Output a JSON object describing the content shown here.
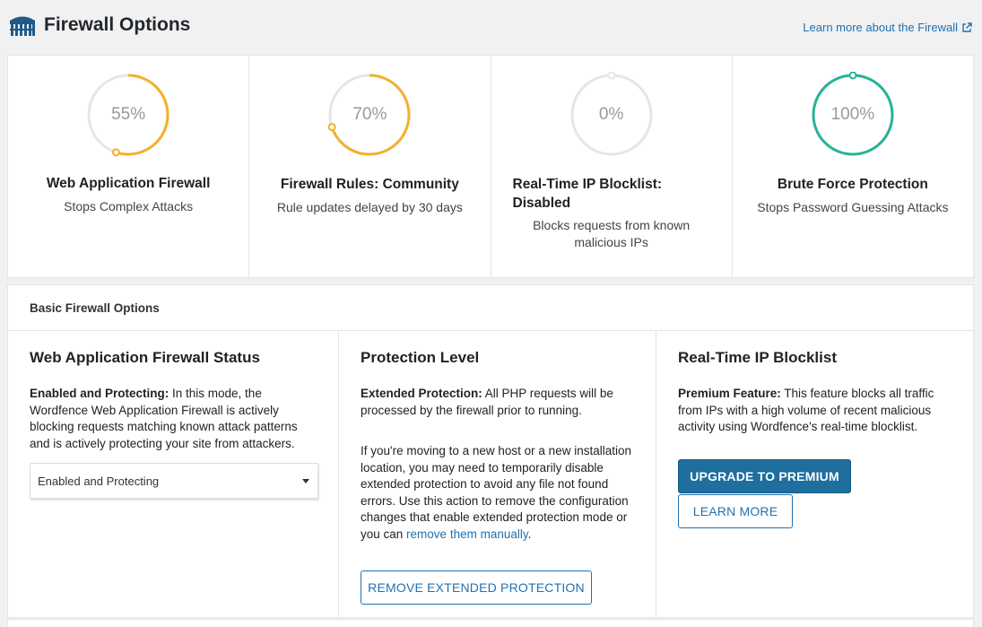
{
  "header": {
    "title": "Firewall Options",
    "learn_more": "Learn more about the Firewall",
    "logo_icon": "wordfence-logo-icon",
    "external_icon": "external-link-icon"
  },
  "colors": {
    "accent": "#2271b1",
    "progress_orange": "#f2b12c",
    "progress_green": "#27b397",
    "track_gray": "#e6e6e6",
    "primary_button": "#1e6e9e"
  },
  "status_cards": [
    {
      "percent_label": "55%",
      "percent": 0.55,
      "color": "#f2b12c",
      "title": "Web Application Firewall",
      "subtitle": "Stops Complex Attacks"
    },
    {
      "percent_label": "70%",
      "percent": 0.7,
      "color": "#f2b12c",
      "title": "Firewall Rules: Community",
      "subtitle": "Rule updates delayed by 30 days"
    },
    {
      "percent_label": "0%",
      "percent": 0.0,
      "color": "#e6e6e6",
      "title": "Real-Time IP Blocklist: Disabled",
      "subtitle": "Blocks requests from known malicious IPs"
    },
    {
      "percent_label": "100%",
      "percent": 1.0,
      "color": "#27b397",
      "title": "Brute Force Protection",
      "subtitle": "Stops Password Guessing Attacks"
    }
  ],
  "basic_options": {
    "header": "Basic Firewall Options",
    "waf_status": {
      "title": "Web Application Firewall Status",
      "bold_lead": "Enabled and Protecting:",
      "text": " In this mode, the Wordfence Web Application Firewall is actively blocking requests matching known attack patterns and is actively protecting your site from attackers.",
      "select_value": "Enabled and Protecting"
    },
    "protection_level": {
      "title": "Protection Level",
      "bold_lead": "Extended Protection:",
      "text": " All PHP requests will be processed by the firewall prior to running.",
      "para2": "If you're moving to a new host or a new installation location, you may need to temporarily disable extended protection to avoid any file not found errors. Use this action to remove the configuration changes that enable extended protection mode or you can ",
      "link": "remove them manually",
      "para2_end": ".",
      "button": "REMOVE EXTENDED PROTECTION"
    },
    "blocklist": {
      "title": "Real-Time IP Blocklist",
      "bold_lead": "Premium Feature:",
      "text": " This feature blocks all traffic from IPs with a high volume of recent malicious activity using Wordfence's real-time blocklist.",
      "upgrade_button": "UPGRADE TO PREMIUM",
      "learn_button": "LEARN MORE"
    }
  }
}
